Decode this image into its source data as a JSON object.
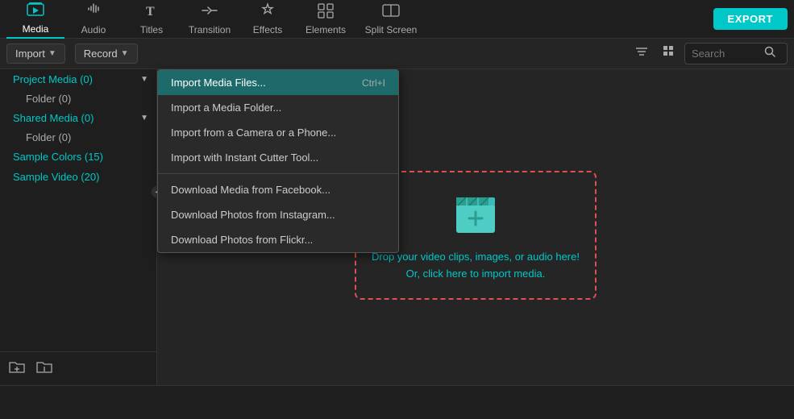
{
  "nav": {
    "items": [
      {
        "id": "media",
        "label": "Media",
        "icon": "🖼",
        "active": true
      },
      {
        "id": "audio",
        "label": "Audio",
        "icon": "♪",
        "active": false
      },
      {
        "id": "titles",
        "label": "Titles",
        "icon": "T",
        "active": false
      },
      {
        "id": "transition",
        "label": "Transition",
        "icon": "⇄",
        "active": false
      },
      {
        "id": "effects",
        "label": "Effects",
        "icon": "✦",
        "active": false
      },
      {
        "id": "elements",
        "label": "Elements",
        "icon": "⊞",
        "active": false
      },
      {
        "id": "splitscreen",
        "label": "Split Screen",
        "icon": "⊡",
        "active": false
      }
    ],
    "export_label": "EXPORT"
  },
  "toolbar": {
    "import_label": "Import",
    "record_label": "Record",
    "search_placeholder": "Search"
  },
  "sidebar": {
    "items": [
      {
        "label": "Project Media (0)",
        "has_chevron": true,
        "color": "teal"
      },
      {
        "label": "Folder (0)",
        "indent": true
      },
      {
        "label": "Shared Media (0)",
        "has_chevron": true,
        "color": "teal"
      },
      {
        "label": "Folder (0)",
        "indent": true
      },
      {
        "label": "Sample Colors (15)",
        "color": "teal"
      },
      {
        "label": "Sample Video (20)",
        "color": "teal"
      }
    ],
    "bottom_buttons": [
      "add-folder",
      "add-file"
    ]
  },
  "dropdown": {
    "items": [
      {
        "label": "Import Media Files...",
        "shortcut": "Ctrl+I",
        "highlighted": true
      },
      {
        "label": "Import a Media Folder...",
        "shortcut": ""
      },
      {
        "label": "Import from a Camera or a Phone...",
        "shortcut": ""
      },
      {
        "label": "Import with Instant Cutter Tool...",
        "shortcut": ""
      },
      {
        "divider": true
      },
      {
        "label": "Download Media from Facebook...",
        "shortcut": ""
      },
      {
        "label": "Download Photos from Instagram...",
        "shortcut": ""
      },
      {
        "label": "Download Photos from Flickr...",
        "shortcut": ""
      }
    ]
  },
  "dropzone": {
    "line1": "Drop your video clips, images, or audio here!",
    "line2": "Or, click here to import media."
  }
}
